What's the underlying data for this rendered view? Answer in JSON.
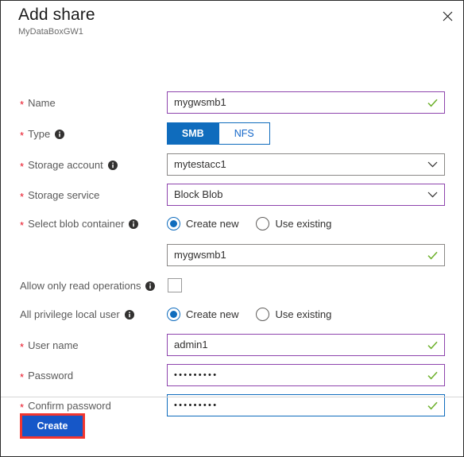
{
  "dialog": {
    "title": "Add share",
    "subtitle": "MyDataBoxGW1",
    "close_icon": "close-icon"
  },
  "colors": {
    "accent_blue": "#0f6cbd",
    "validated_purple": "#8e44ad",
    "focus_blue": "#0f6cbd",
    "required_red": "#e81123",
    "success_green": "#6cb02a",
    "highlight_red": "#f2362f",
    "create_button_blue": "#1657c8"
  },
  "fields": {
    "name": {
      "label": "Name",
      "required": true,
      "has_info": false,
      "value": "mygwsmb1",
      "valid": true,
      "border": "purple"
    },
    "type": {
      "label": "Type",
      "required": true,
      "has_info": true,
      "options": [
        "SMB",
        "NFS"
      ],
      "selected": "SMB"
    },
    "storage_account": {
      "label": "Storage account",
      "required": true,
      "has_info": true,
      "value": "mytestacc1",
      "border": "gray"
    },
    "storage_service": {
      "label": "Storage service",
      "required": true,
      "has_info": false,
      "value": "Block Blob",
      "border": "purple"
    },
    "select_blob_container": {
      "label": "Select blob container",
      "required": true,
      "has_info": true,
      "options": [
        "Create new",
        "Use existing"
      ],
      "selected": "Create new",
      "value": "mygwsmb1",
      "valid": true,
      "border": "gray"
    },
    "allow_read_only": {
      "label": "Allow only read operations",
      "required": false,
      "has_info": true,
      "checked": false
    },
    "all_privilege_local_user": {
      "label": "All privilege local user",
      "required": false,
      "has_info": true,
      "options": [
        "Create new",
        "Use existing"
      ],
      "selected": "Create new"
    },
    "user_name": {
      "label": "User name",
      "required": true,
      "has_info": false,
      "value": "admin1",
      "valid": true,
      "border": "purple"
    },
    "password": {
      "label": "Password",
      "required": true,
      "has_info": false,
      "value": "•••••••••",
      "valid": true,
      "border": "purple"
    },
    "confirm_password": {
      "label": "Confirm password",
      "required": true,
      "has_info": false,
      "value": "•••••••••",
      "valid": true,
      "border": "blue"
    }
  },
  "footer": {
    "create_label": "Create"
  }
}
